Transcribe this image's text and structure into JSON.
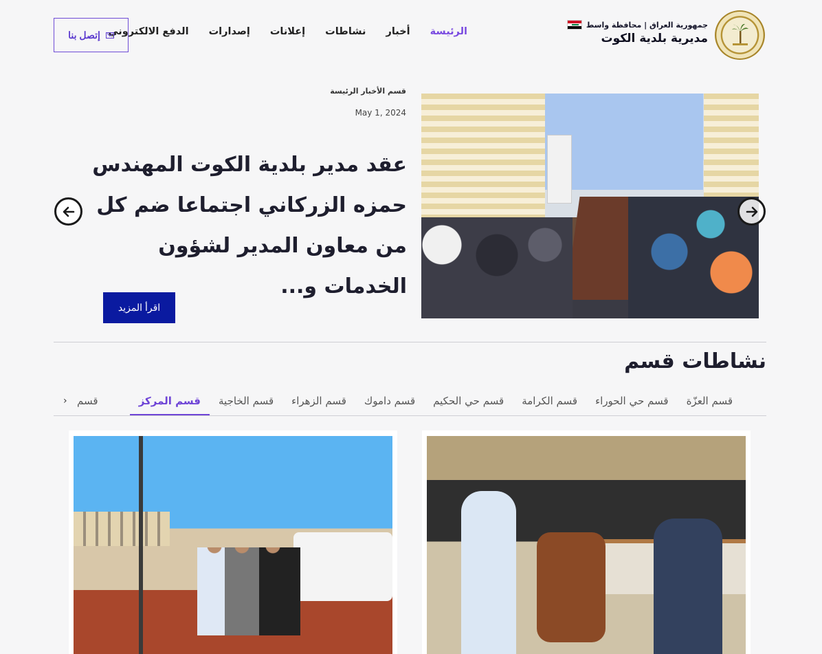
{
  "header": {
    "subtitle": "جمهورية العراق | محافظة واسط",
    "title": "مديرية بلدية الكوت",
    "nav": [
      {
        "label": "الرئيسة",
        "active": true
      },
      {
        "label": "أخبار",
        "active": false
      },
      {
        "label": "نشاطات",
        "active": false
      },
      {
        "label": "إعلانات",
        "active": false
      },
      {
        "label": "إصدارات",
        "active": false
      },
      {
        "label": "الدفع الالكتروني",
        "active": false
      }
    ],
    "contact_label": "إتصل بنا"
  },
  "hero": {
    "category": "قسم الأخبار الرئيسة",
    "date": "May 1, 2024",
    "headline": "عقد مدير بلدية الكوت المهندس حمزه الزركاني اجتماعا ضم كل من معاون المدير لشؤون الخدمات و...",
    "read_more": "اقرأ المزيد"
  },
  "activities": {
    "title": "نشاطات قسم",
    "tabs": [
      {
        "label": "قسم المركز",
        "active": true
      },
      {
        "label": "قسم الخاجية",
        "active": false
      },
      {
        "label": "قسم الزهراء",
        "active": false
      },
      {
        "label": "قسم داموك",
        "active": false
      },
      {
        "label": "قسم حي الحكيم",
        "active": false
      },
      {
        "label": "قسم الكرامة",
        "active": false
      },
      {
        "label": "قسم حي الحوراء",
        "active": false
      },
      {
        "label": "قسم العزّة",
        "active": false
      }
    ],
    "tab_overflow": "قسم"
  },
  "colors": {
    "accent": "#6e44d6",
    "primary_button": "#0a1aa0",
    "background": "#f6f6f7"
  },
  "icons": {
    "contact": "envelope-icon",
    "prev": "arrow-left-icon",
    "next": "arrow-right-icon",
    "tabs_more": "chevron-right-icon"
  }
}
